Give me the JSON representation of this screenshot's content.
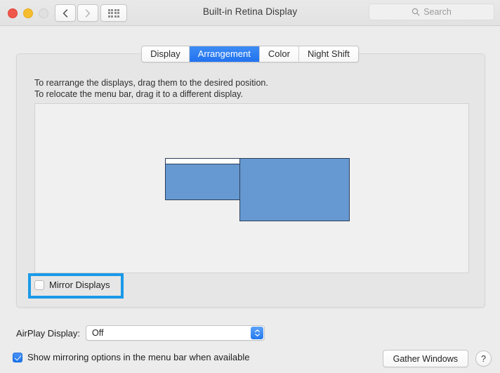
{
  "window": {
    "title": "Built-in Retina Display",
    "traffic_lights": [
      {
        "name": "close",
        "color": "#f0564c"
      },
      {
        "name": "minimize",
        "color": "#f5bc2e"
      },
      {
        "name": "zoom",
        "color": "#e0e0e0"
      }
    ],
    "nav": {
      "back_icon": "chevron-left-icon",
      "forward_icon": "chevron-right-icon",
      "show_all_icon": "grid-dots-icon"
    },
    "search": {
      "placeholder": "Search",
      "icon": "search-icon"
    }
  },
  "tabs": [
    {
      "label": "Display",
      "selected": false
    },
    {
      "label": "Arrangement",
      "selected": true
    },
    {
      "label": "Color",
      "selected": false
    },
    {
      "label": "Night Shift",
      "selected": false
    }
  ],
  "panel": {
    "instruction_line_1": "To rearrange the displays, drag them to the desired position.",
    "instruction_line_2": "To relocate the menu bar, drag it to a different display.",
    "displays": [
      {
        "name": "secondary-display",
        "has_menu_bar": true,
        "color": "#6699d1"
      },
      {
        "name": "main-display",
        "has_menu_bar": false,
        "color": "#6699d1"
      }
    ],
    "mirror_displays": {
      "label": "Mirror Displays",
      "checked": false
    }
  },
  "annotation": {
    "color": "#1a9ae8",
    "target": "mirror-displays-checkbox"
  },
  "bottom": {
    "airplay_label": "AirPlay Display:",
    "airplay_value": "Off",
    "show_mirroring": {
      "label": "Show mirroring options in the menu bar when available",
      "checked": true
    },
    "gather_windows_label": "Gather Windows",
    "help_label": "?"
  },
  "colors": {
    "accent_blue": "#2172ef",
    "display_blue": "#6699d1",
    "annotation_blue": "#1a9ae8"
  }
}
